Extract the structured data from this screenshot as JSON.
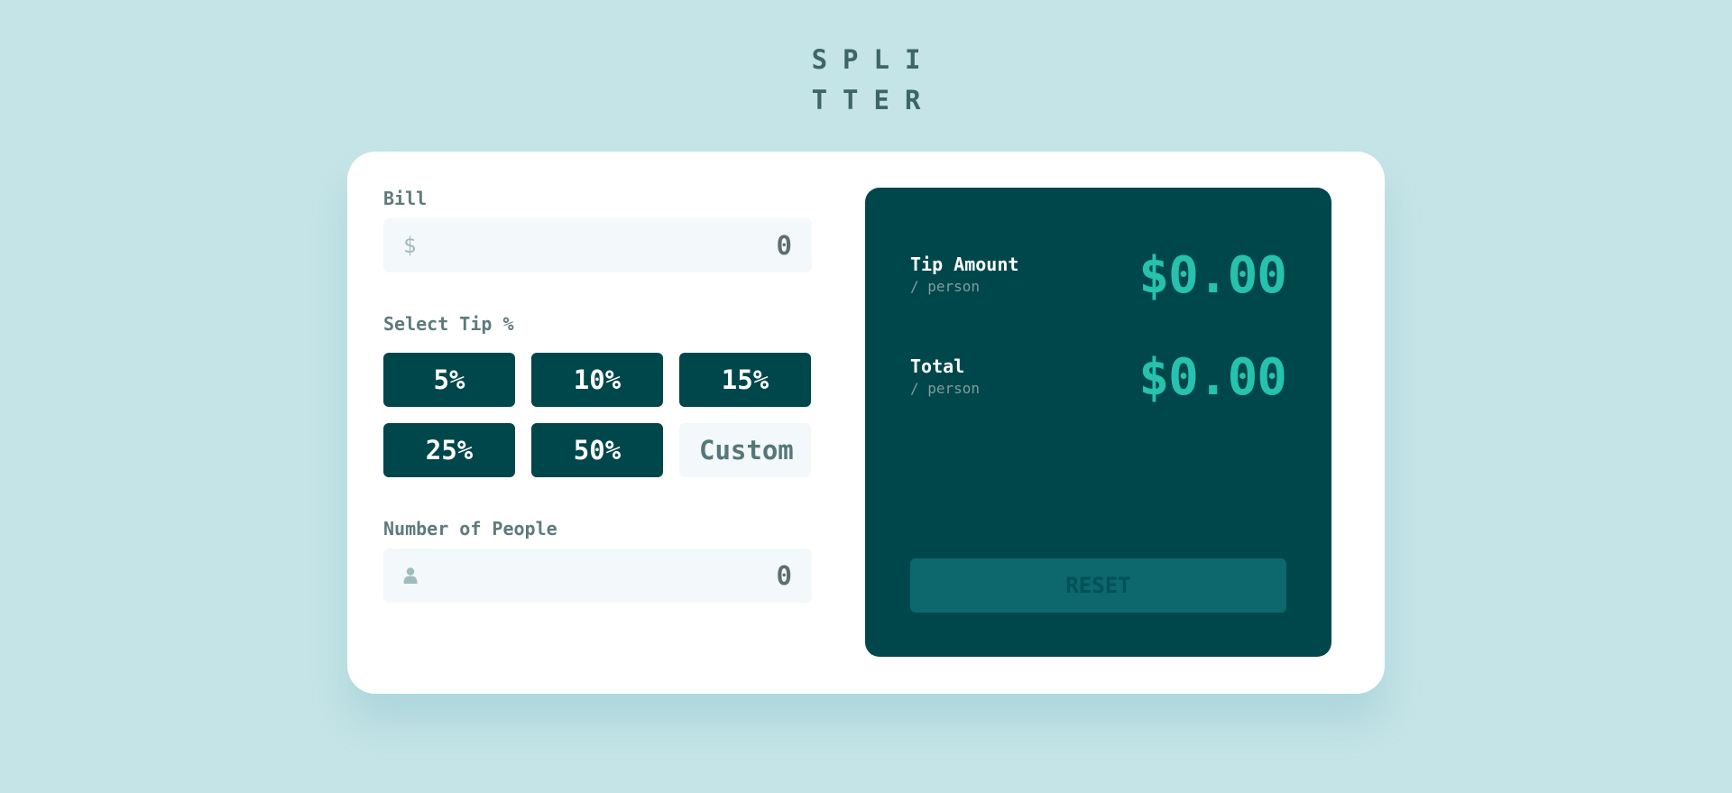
{
  "logo": {
    "line1": "SPLI",
    "line2": "TTER"
  },
  "bill": {
    "label": "Bill",
    "icon": "dollar-icon",
    "icon_glyph": "$",
    "value": "0"
  },
  "tip_section": {
    "label": "Select Tip %",
    "options": [
      "5%",
      "10%",
      "15%",
      "25%",
      "50%"
    ],
    "custom_placeholder": "Custom"
  },
  "people": {
    "label": "Number of People",
    "icon": "person-icon",
    "value": "0"
  },
  "results": {
    "tip": {
      "label": "Tip Amount",
      "sub": "/ person",
      "amount": "$0.00"
    },
    "total": {
      "label": "Total",
      "sub": "/ person",
      "amount": "$0.00"
    },
    "reset_label": "RESET"
  },
  "colors": {
    "background": "#c5e4e7",
    "dark_cyan": "#00474b",
    "accent": "#26c2ad",
    "reset_disabled": "#0d686d"
  }
}
